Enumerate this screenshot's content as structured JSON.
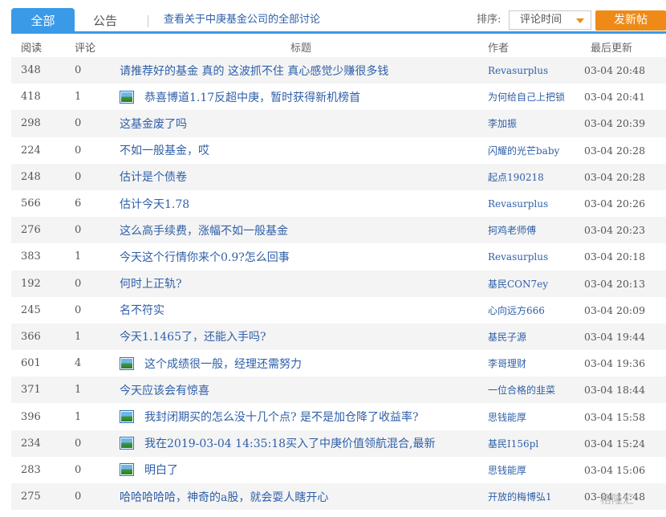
{
  "tabs": {
    "all": "全部",
    "notice": "公告",
    "all_discussions": "查看关于中庚基金公司的全部讨论"
  },
  "sort": {
    "label": "排序:",
    "selected": "评论时间"
  },
  "post_button": "发新帖",
  "columns": {
    "read": "阅读",
    "comments": "评论",
    "title": "标题",
    "author": "作者",
    "updated": "最后更新"
  },
  "rows": [
    {
      "read": "348",
      "comments": "0",
      "title": "请推荐好的基金 真的 这波抓不住 真心感觉少赚很多钱",
      "author": "Revasurplus",
      "updated": "03-04 20:48",
      "has_image": false
    },
    {
      "read": "418",
      "comments": "1",
      "title": "恭喜博道1.17反超中庚，暂时获得新机榜首",
      "author": "为何给自己上把锁",
      "updated": "03-04 20:41",
      "has_image": true
    },
    {
      "read": "298",
      "comments": "0",
      "title": "这基金废了吗",
      "author": "李加振",
      "updated": "03-04 20:39",
      "has_image": false
    },
    {
      "read": "224",
      "comments": "0",
      "title": "不如一般基金，哎",
      "author": "闪耀的光芒baby",
      "updated": "03-04 20:28",
      "has_image": false
    },
    {
      "read": "248",
      "comments": "0",
      "title": "估计是个债卷",
      "author": "起点190218",
      "updated": "03-04 20:28",
      "has_image": false
    },
    {
      "read": "566",
      "comments": "6",
      "title": "估计今天1.78",
      "author": "Revasurplus",
      "updated": "03-04 20:26",
      "has_image": false
    },
    {
      "read": "276",
      "comments": "0",
      "title": "这么高手续费，涨幅不如一般基金",
      "author": "抲鸡老师傅",
      "updated": "03-04 20:23",
      "has_image": false
    },
    {
      "read": "383",
      "comments": "1",
      "title": "今天这个行情你来个0.9?怎么回事",
      "author": "Revasurplus",
      "updated": "03-04 20:18",
      "has_image": false
    },
    {
      "read": "192",
      "comments": "0",
      "title": "何时上正轨?",
      "author": "基民CON7ey",
      "updated": "03-04 20:13",
      "has_image": false
    },
    {
      "read": "245",
      "comments": "0",
      "title": "名不符实",
      "author": "心向远方666",
      "updated": "03-04 20:09",
      "has_image": false
    },
    {
      "read": "366",
      "comments": "1",
      "title": "今天1.1465了，还能入手吗?",
      "author": "基民子源",
      "updated": "03-04 19:44",
      "has_image": false
    },
    {
      "read": "601",
      "comments": "4",
      "title": "这个成绩很一般，经理还需努力",
      "author": "李哥理财",
      "updated": "03-04 19:36",
      "has_image": true
    },
    {
      "read": "371",
      "comments": "1",
      "title": "今天应该会有惊喜",
      "author": "一位合格的韭菜",
      "updated": "03-04 18:44",
      "has_image": false
    },
    {
      "read": "396",
      "comments": "1",
      "title": "我封闭期买的怎么没十几个点? 是不是加仓降了收益率?",
      "author": "思钱能厚",
      "updated": "03-04 15:58",
      "has_image": true
    },
    {
      "read": "234",
      "comments": "0",
      "title": "我在2019-03-04 14:35:18买入了中庚价值领航混合,最新",
      "author": "基民I156pl",
      "updated": "03-04 15:24",
      "has_image": true
    },
    {
      "read": "283",
      "comments": "0",
      "title": "明白了",
      "author": "思钱能厚",
      "updated": "03-04 15:06",
      "has_image": true
    },
    {
      "read": "275",
      "comments": "0",
      "title": "哈哈哈哈哈，神奇的a股，就会耍人瞎开心",
      "author": "开放的梅博弘1",
      "updated": "03-04 14:48",
      "has_image": false
    }
  ],
  "watermark": "格隆汇",
  "colors": {
    "accent_blue": "#3a9ae8",
    "button_orange": "#f08a17",
    "link_blue": "#2e5fa8",
    "row_stripe": "#f4f4f4"
  }
}
